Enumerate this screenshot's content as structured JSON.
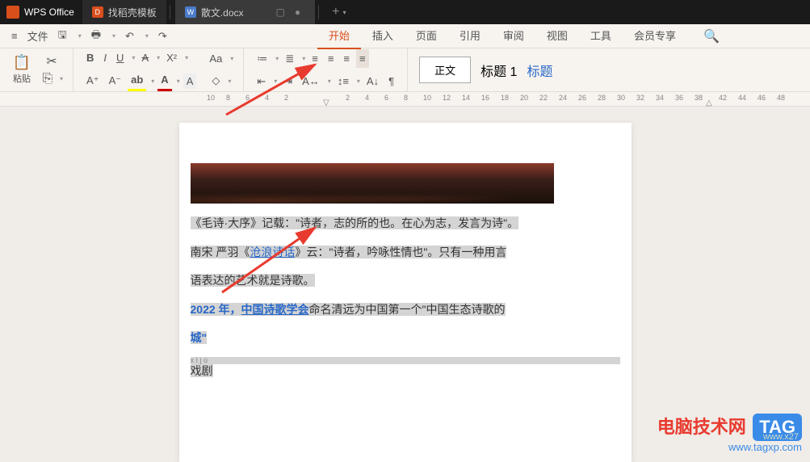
{
  "app": {
    "name": "WPS Office"
  },
  "tabs": [
    {
      "icon": "orange",
      "label": "找稻壳模板"
    },
    {
      "icon": "blue",
      "label": "散文.docx"
    }
  ],
  "menu": {
    "file": "文件",
    "items": [
      "开始",
      "插入",
      "页面",
      "引用",
      "审阅",
      "视图",
      "工具",
      "会员专享"
    ],
    "active": 0
  },
  "toolbar": {
    "paste": "粘贴",
    "styles": {
      "normal": "正文",
      "heading1": "标题 1",
      "heading": "标题"
    }
  },
  "ruler": {
    "left_marks": [
      10,
      8,
      6,
      4,
      2
    ],
    "right_marks": [
      2,
      4,
      6,
      8,
      10,
      12,
      14,
      16,
      18,
      20,
      22,
      24,
      26,
      28,
      30,
      32,
      34,
      36,
      38,
      42,
      44,
      46,
      48
    ]
  },
  "document": {
    "para1_a": "《毛诗·大序》记载：\"诗者，志的所的也。在心为志，发言为诗\"。",
    "para1_b": "南宋 严羽《",
    "para1_link": "沧浪诗话",
    "para1_c": "》云：\"诗者，吟咏性情也\"。只有一种用言",
    "para1_d": "语表达的艺术就是诗歌。",
    "para2_a": "2022 年，",
    "para2_link": "中国诗歌学会",
    "para2_b": "命名清远为中国第一个\"中国生态诗歌的",
    "para2_c": "城\"",
    "para3_ruby": "x ì j ù",
    "para3": "戏剧"
  },
  "watermark": {
    "main": "电脑技术网",
    "tag": "TAG",
    "url": "www.tagxp.com",
    "ghost": "www.x27"
  }
}
